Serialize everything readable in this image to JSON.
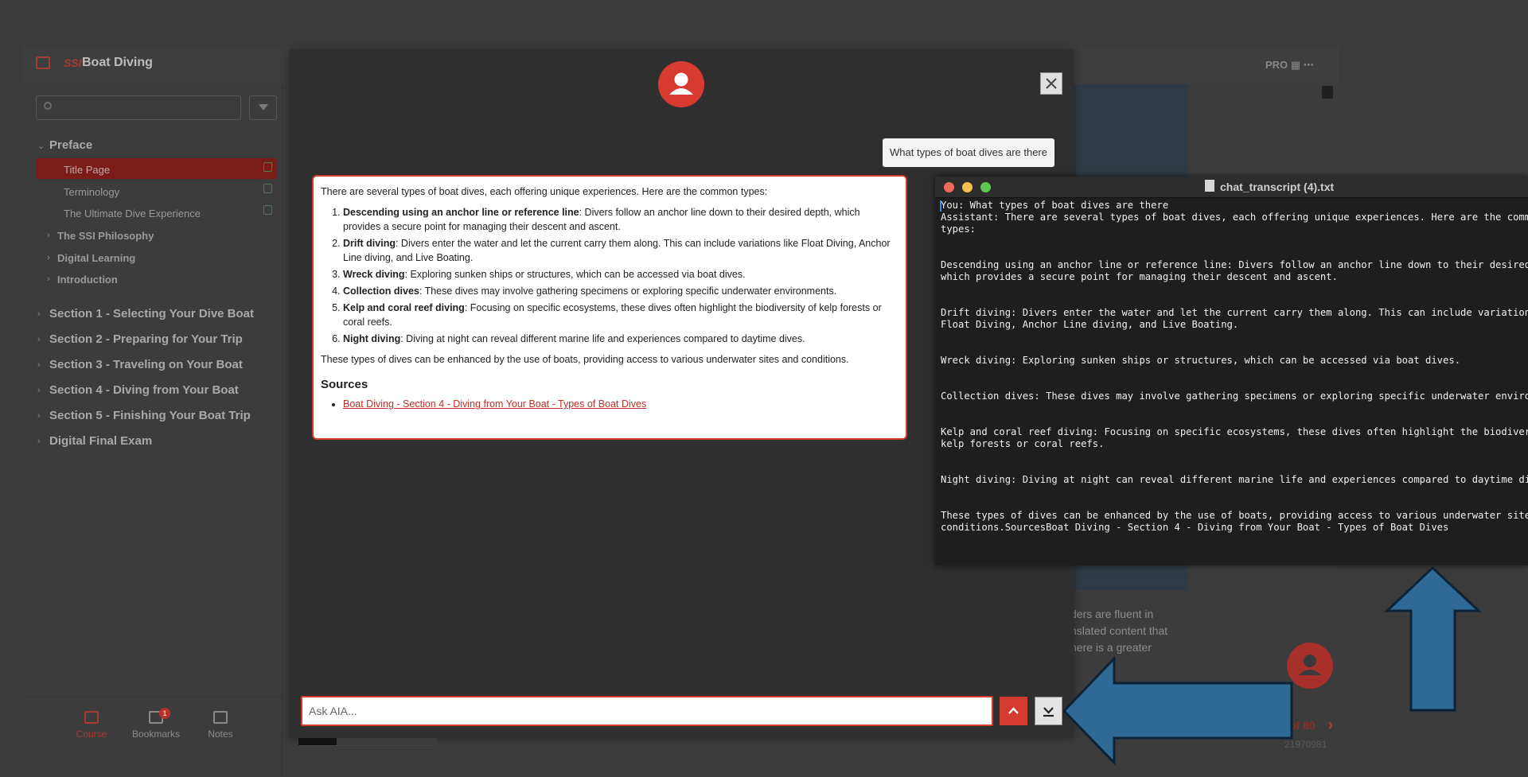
{
  "app": {
    "brand_logo": "SSI",
    "title": "Boat Diving",
    "topbar_icons": "PRO  ▦  ⋯"
  },
  "sidebar": {
    "toc": [
      {
        "label": "Preface",
        "level": 0,
        "expanded": true
      },
      {
        "label": "Title Page",
        "level": 2,
        "active": true,
        "completed": true
      },
      {
        "label": "Terminology",
        "level": 2,
        "completed": true
      },
      {
        "label": "The Ultimate Dive Experience",
        "level": 2,
        "completed": true
      },
      {
        "label": "The SSI Philosophy",
        "level": 1
      },
      {
        "label": "Digital Learning",
        "level": 1
      },
      {
        "label": "Introduction",
        "level": 1
      },
      {
        "label": "Section 1 - Selecting Your Dive Boat",
        "level": 0
      },
      {
        "label": "Section 2 - Preparing for Your Trip",
        "level": 0
      },
      {
        "label": "Section 3 - Traveling on Your Boat",
        "level": 0
      },
      {
        "label": "Section 4 - Diving from Your Boat",
        "level": 0
      },
      {
        "label": "Section 5 - Finishing Your Boat Trip",
        "level": 0
      },
      {
        "label": "Digital Final Exam",
        "level": 0
      }
    ],
    "bottom_nav": {
      "course": "Course",
      "bookmarks": "Bookmarks",
      "bookmarks_badge": "1",
      "notes": "Notes"
    }
  },
  "reader": {
    "text_lines": [
      "ders are fluent in",
      "nslated content that",
      "here is a greater"
    ],
    "page_counter": "of 80",
    "page_id": "21970981"
  },
  "chat": {
    "user_message": "What types of boat dives are there",
    "intro": "There are several types of boat dives, each offering unique experiences. Here are the common types:",
    "items": [
      {
        "term": "Descending using an anchor line or reference line",
        "desc": ": Divers follow an anchor line down to their desired depth, which provides a secure point for managing their descent and ascent."
      },
      {
        "term": "Drift diving",
        "desc": ": Divers enter the water and let the current carry them along. This can include variations like Float Diving, Anchor Line diving, and Live Boating."
      },
      {
        "term": "Wreck diving",
        "desc": ": Exploring sunken ships or structures, which can be accessed via boat dives."
      },
      {
        "term": "Collection dives",
        "desc": ": These dives may involve gathering specimens or exploring specific underwater environments."
      },
      {
        "term": "Kelp and coral reef diving",
        "desc": ": Focusing on specific ecosystems, these dives often highlight the biodiversity of kelp forests or coral reefs."
      },
      {
        "term": "Night diving",
        "desc": ": Diving at night can reveal different marine life and experiences compared to daytime dives."
      }
    ],
    "outro": "These types of dives can be enhanced by the use of boats, providing access to various underwater sites and conditions.",
    "sources_heading": "Sources",
    "source_link": "Boat Diving - Section 4 - Diving from Your Boat - Types of Boat Dives",
    "input_placeholder": "Ask AIA..."
  },
  "editor": {
    "title": "chat_transcript (4).txt",
    "lines": [
      "You: What types of boat dives are there",
      "Assistant: There are several types of boat dives, each offering unique experiences. Here are the common",
      "types:",
      "",
      "",
      "Descending using an anchor line or reference line: Divers follow an anchor line down to their desired depth,",
      "which provides a secure point for managing their descent and ascent.",
      "",
      "",
      "Drift diving: Divers enter the water and let the current carry them along. This can include variations like",
      "Float Diving, Anchor Line diving, and Live Boating.",
      "",
      "",
      "Wreck diving: Exploring sunken ships or structures, which can be accessed via boat dives.",
      "",
      "",
      "Collection dives: These dives may involve gathering specimens or exploring specific underwater environments.",
      "",
      "",
      "Kelp and coral reef diving: Focusing on specific ecosystems, these dives often highlight the biodiversity of",
      "kelp forests or coral reefs.",
      "",
      "",
      "Night diving: Diving at night can reveal different marine life and experiences compared to daytime dives.",
      "",
      "",
      "These types of dives can be enhanced by the use of boats, providing access to various underwater sites and",
      "conditions.SourcesBoat Diving - Section 4 - Diving from Your Boat - Types of Boat Dives"
    ]
  },
  "colors": {
    "accent": "#d33a30",
    "arrow_fill": "#2f6a96",
    "arrow_stroke": "#0c2236"
  }
}
